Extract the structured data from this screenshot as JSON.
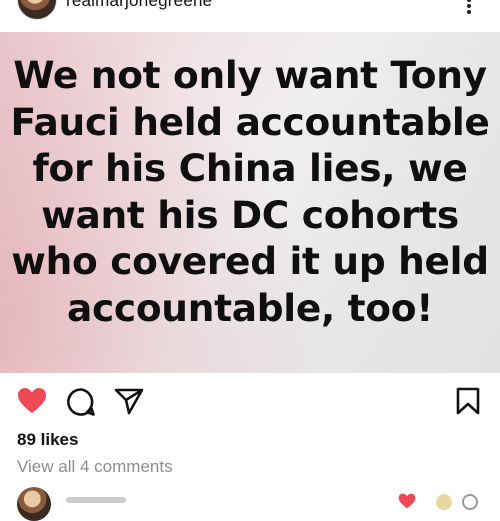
{
  "header": {
    "username": "realmarjoriegreene",
    "avatar_icon": "profile-avatar",
    "more_icon": "more-vertical-icon"
  },
  "post": {
    "text_lines": [
      "We not only want Tony",
      "Fauci held accountable",
      "for his China lies, we",
      "want his DC cohorts",
      "who covered it up held",
      "accountable, too!"
    ]
  },
  "actions": {
    "like_icon": "heart-icon",
    "comment_icon": "comment-icon",
    "share_icon": "share-icon",
    "save_icon": "bookmark-icon",
    "like_color": "#ed4956"
  },
  "stats": {
    "likes": "89 likes",
    "view_comments": "View all 4 comments"
  }
}
